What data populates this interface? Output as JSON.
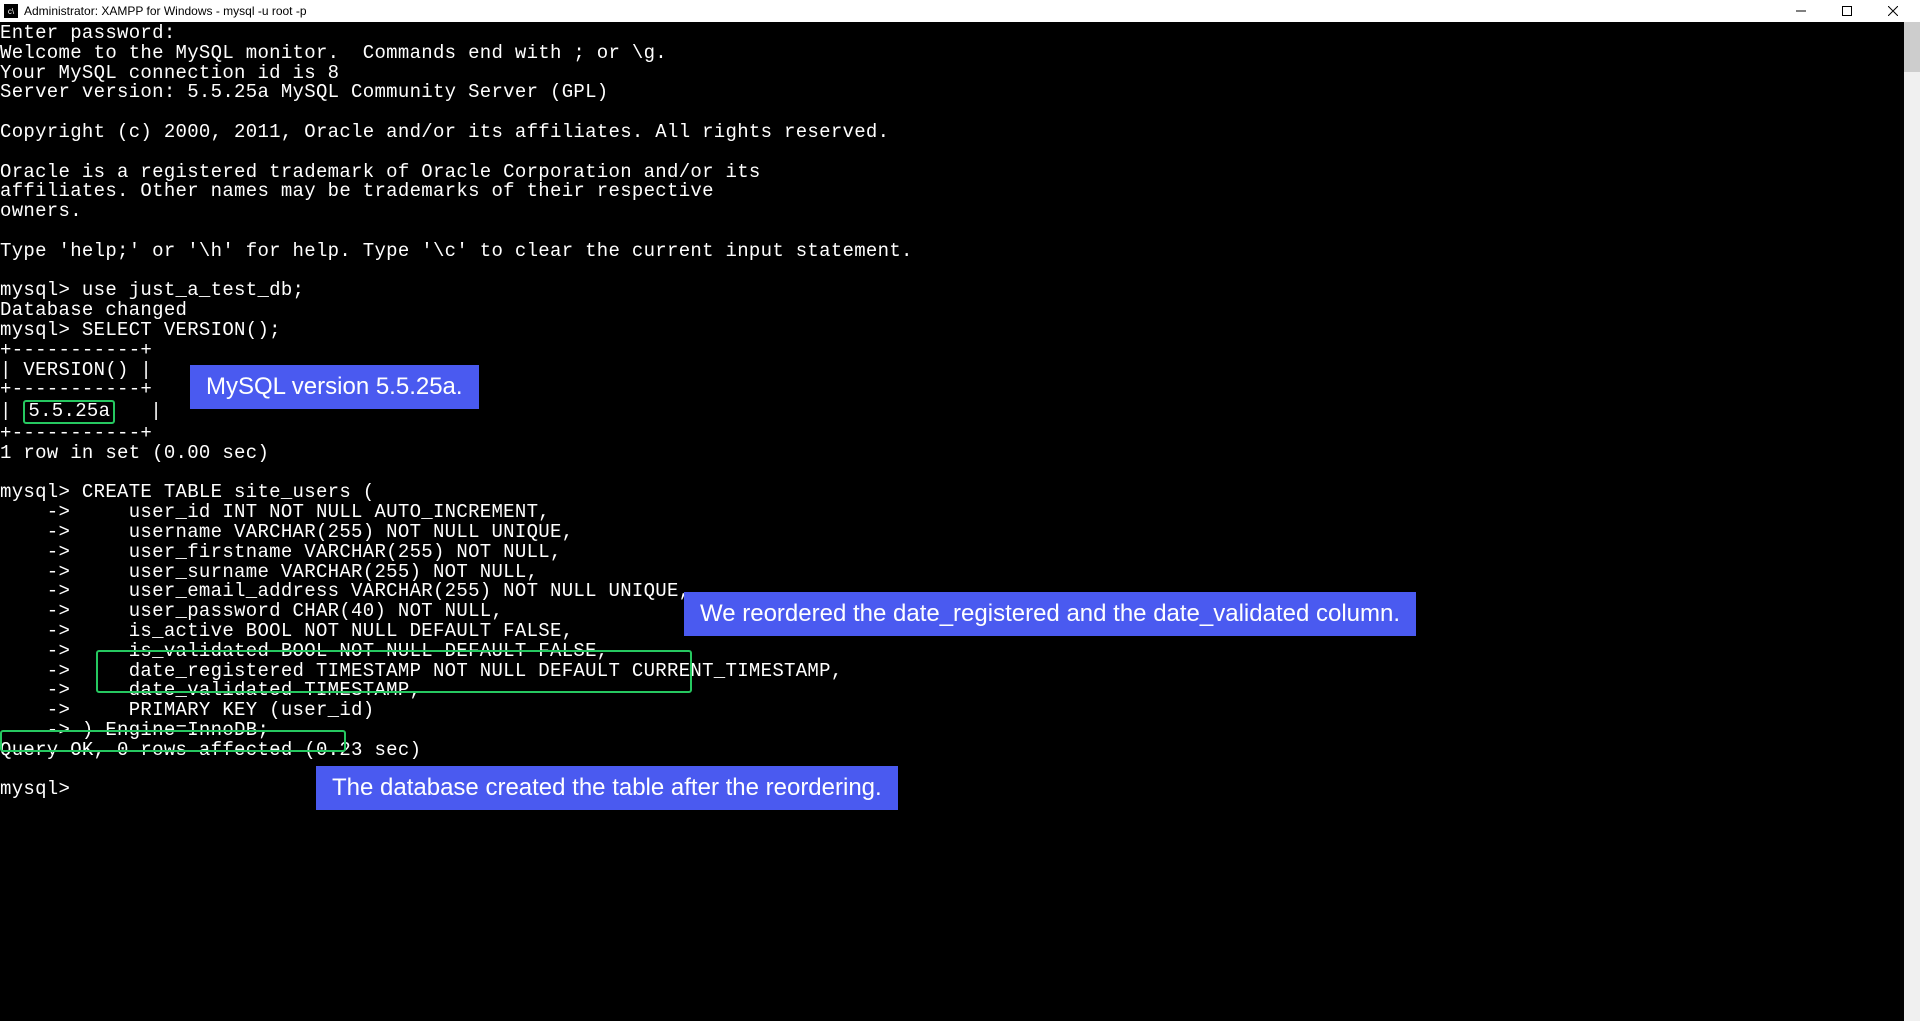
{
  "window": {
    "title": "Administrator:  XAMPP for Windows - mysql  -u root -p",
    "icon_label": "cmd-icon"
  },
  "terminal": {
    "lines": [
      "Enter password:",
      "Welcome to the MySQL monitor.  Commands end with ; or \\g.",
      "Your MySQL connection id is 8",
      "Server version: 5.5.25a MySQL Community Server (GPL)",
      "",
      "Copyright (c) 2000, 2011, Oracle and/or its affiliates. All rights reserved.",
      "",
      "Oracle is a registered trademark of Oracle Corporation and/or its",
      "affiliates. Other names may be trademarks of their respective",
      "owners.",
      "",
      "Type 'help;' or '\\h' for help. Type '\\c' to clear the current input statement.",
      "",
      "mysql> use just_a_test_db;",
      "Database changed",
      "mysql> SELECT VERSION();",
      "+-----------+",
      "| VERSION() |",
      "+-----------+"
    ],
    "version_cell_pre": "| ",
    "version_value": "5.5.25a",
    "version_cell_post": "   |",
    "lines2": [
      "+-----------+",
      "1 row in set (0.00 sec)",
      "",
      "mysql> CREATE TABLE site_users (",
      "    ->     user_id INT NOT NULL AUTO_INCREMENT,",
      "    ->     username VARCHAR(255) NOT NULL UNIQUE,",
      "    ->     user_firstname VARCHAR(255) NOT NULL,",
      "    ->     user_surname VARCHAR(255) NOT NULL,",
      "    ->     user_email_address VARCHAR(255) NOT NULL UNIQUE,",
      "    ->     user_password CHAR(40) NOT NULL,",
      "    ->     is_active BOOL NOT NULL DEFAULT FALSE,",
      "    ->     is_validated BOOL NOT NULL DEFAULT FALSE,",
      "    ->     date_registered TIMESTAMP NOT NULL DEFAULT CURRENT_TIMESTAMP,",
      "    ->     date_validated TIMESTAMP,",
      "    ->     PRIMARY KEY (user_id)",
      "    -> ) Engine=InnoDB;",
      "Query OK, 0 rows affected (0.23 sec)",
      "",
      "mysql>"
    ]
  },
  "callouts": {
    "version": "MySQL version 5.5.25a.",
    "reorder": "We reordered the date_registered and the date_validated column.",
    "created": "The database created the table after the reordering."
  }
}
